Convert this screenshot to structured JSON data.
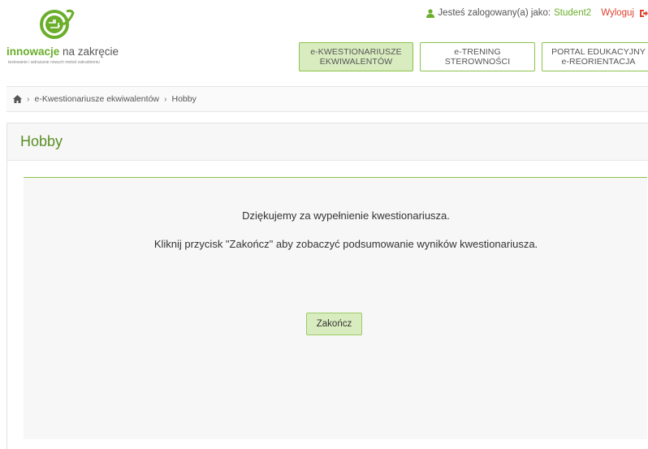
{
  "header": {
    "logo_bold": "innowacje",
    "logo_rest": " na zakręcie",
    "logo_tagline": "testowanie i wdrażanie nowych metod zatrudnieniu",
    "user_prefix": "Jesteś zalogowany(a) jako:",
    "username": "Student2",
    "logout_label": "Wyloguj"
  },
  "nav": {
    "tabs": [
      {
        "line1": "e-KWESTIONARIUSZE",
        "line2": "EKWIWALENTÓW"
      },
      {
        "line1": "e-TRENING",
        "line2": "STEROWNOŚCI"
      },
      {
        "line1": "PORTAL EDUKACYJNY",
        "line2": "e-REORIENTACJA"
      }
    ]
  },
  "breadcrumb": {
    "items": [
      "e-Kwestionariusze ekwiwalentów",
      "Hobby"
    ]
  },
  "panel": {
    "title": "Hobby",
    "message1": "Dziękujemy za wypełnienie kwestionariusza.",
    "message2": "Kliknij przycisk \"Zakończ\" aby zobaczyć podsumowanie wyników kwestionariusza.",
    "finish_label": "Zakończ"
  },
  "colors": {
    "brand_green": "#6aae2a",
    "tab_active_bg": "#d8ecbf",
    "logout_red": "#e0402f"
  }
}
